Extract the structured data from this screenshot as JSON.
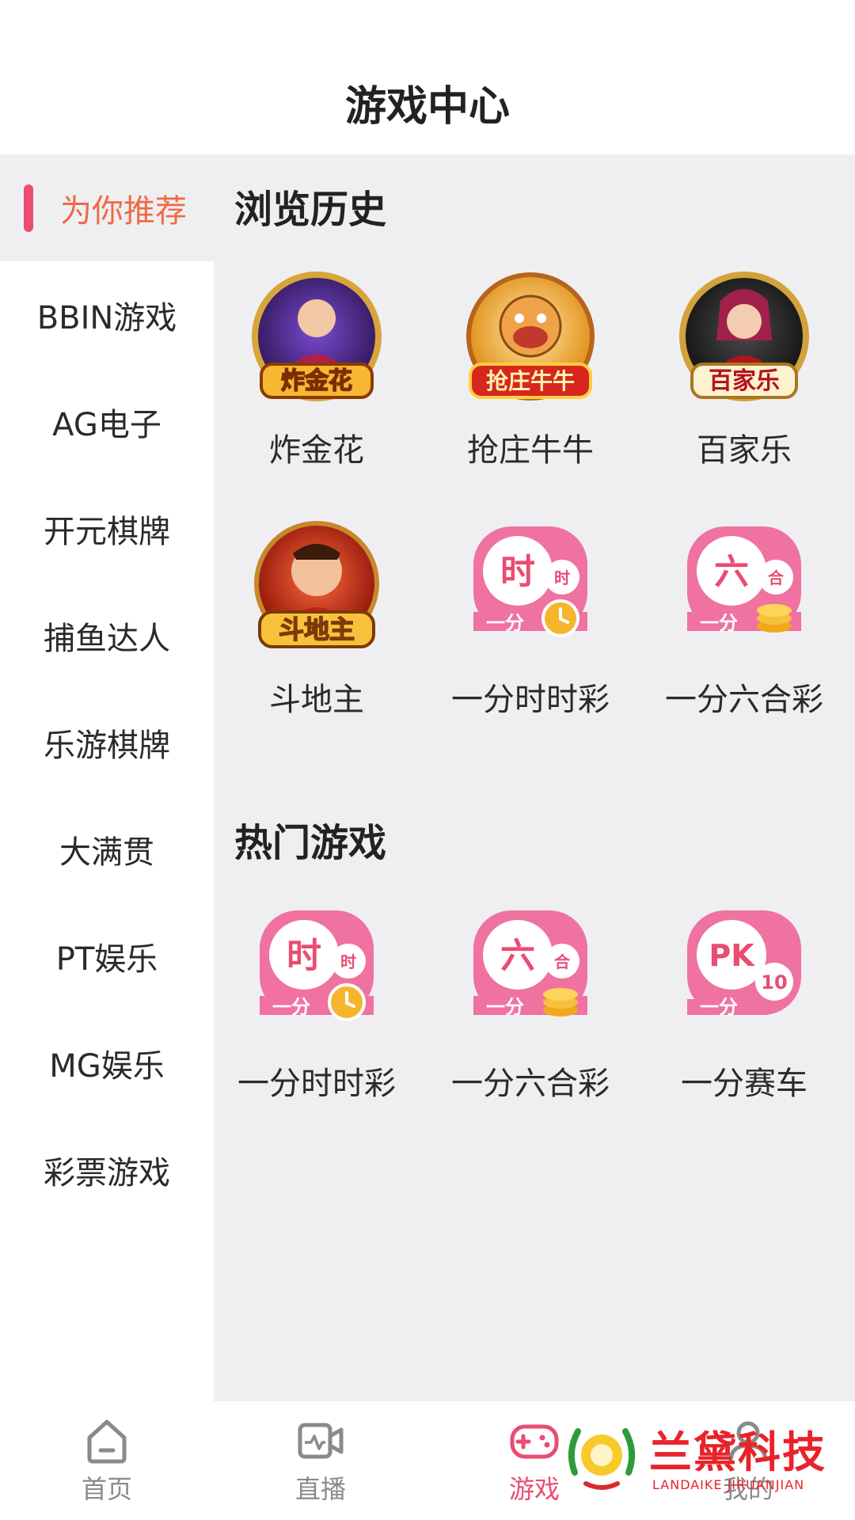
{
  "header": {
    "title": "游戏中心"
  },
  "sidebar": {
    "items": [
      {
        "label": "为你推荐",
        "active": true
      },
      {
        "label": "BBIN游戏"
      },
      {
        "label": "AG电子"
      },
      {
        "label": "开元棋牌"
      },
      {
        "label": "捕鱼达人"
      },
      {
        "label": "乐游棋牌"
      },
      {
        "label": "大满贯"
      },
      {
        "label": "PT娱乐"
      },
      {
        "label": "MG娱乐"
      },
      {
        "label": "彩票游戏"
      }
    ]
  },
  "sections": {
    "history": {
      "title": "浏览历史",
      "games": [
        {
          "name": "炸金花",
          "icon": "zhajinhua-icon",
          "badge": "炸金花"
        },
        {
          "name": "抢庄牛牛",
          "icon": "qiangzhuang-niuniu-icon",
          "badge": "抢庄牛牛"
        },
        {
          "name": "百家乐",
          "icon": "baijiale-icon",
          "badge": "百家乐"
        },
        {
          "name": "斗地主",
          "icon": "doudizhu-icon",
          "badge": "斗地主"
        },
        {
          "name": "一分时时彩",
          "icon": "yifen-shishicai-icon",
          "big": "时",
          "small": "时",
          "bottom": "一分"
        },
        {
          "name": "一分六合彩",
          "icon": "yifen-liuhecai-icon",
          "big": "六",
          "small": "合",
          "bottom": "一分"
        }
      ]
    },
    "hot": {
      "title": "热门游戏",
      "games": [
        {
          "name": "一分时时彩",
          "icon": "yifen-shishicai-icon",
          "big": "时",
          "small": "时",
          "bottom": "一分"
        },
        {
          "name": "一分六合彩",
          "icon": "yifen-liuhecai-icon",
          "big": "六",
          "small": "合",
          "bottom": "一分"
        },
        {
          "name": "一分赛车",
          "icon": "yifen-saiche-icon",
          "big": "PK",
          "small": "10",
          "bottom": "一分"
        }
      ]
    }
  },
  "tabbar": {
    "items": [
      {
        "label": "首页",
        "icon": "home-icon"
      },
      {
        "label": "直播",
        "icon": "live-video-icon"
      },
      {
        "label": "游戏",
        "icon": "gamepad-icon",
        "active": true
      },
      {
        "label": "我的",
        "icon": "profile-icon"
      }
    ]
  },
  "watermark": {
    "text": "兰黛科技",
    "sub": "LANDAIKE JIRUANJIAN"
  },
  "colors": {
    "accent": "#ea4c72",
    "active_sidebar_text": "#ef6a45",
    "content_bg": "#efeff2"
  }
}
